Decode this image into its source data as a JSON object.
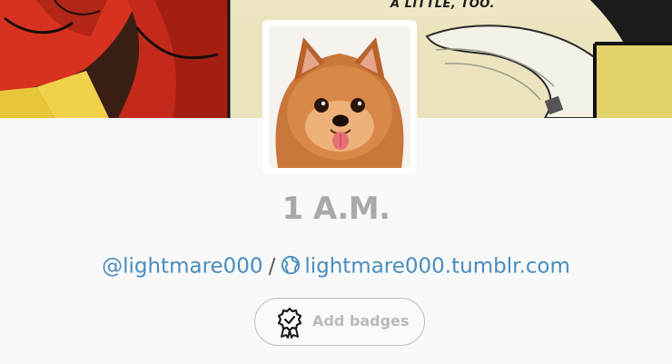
{
  "header": {
    "banner_caption": "A LITTLE, TOO."
  },
  "blog": {
    "title": "1 A.M.",
    "handle": "@lightmare000",
    "separator": "/",
    "url": "lightmare000.tumblr.com"
  },
  "badges": {
    "button_label": "Add badges"
  },
  "icons": {
    "globe": "globe-icon",
    "badge": "badge-ribbon-icon"
  },
  "colors": {
    "link": "#4a8dbf",
    "title": "#a9a9a9",
    "badge_label": "#b9b9b9",
    "page_background": "#f9f9f9"
  }
}
